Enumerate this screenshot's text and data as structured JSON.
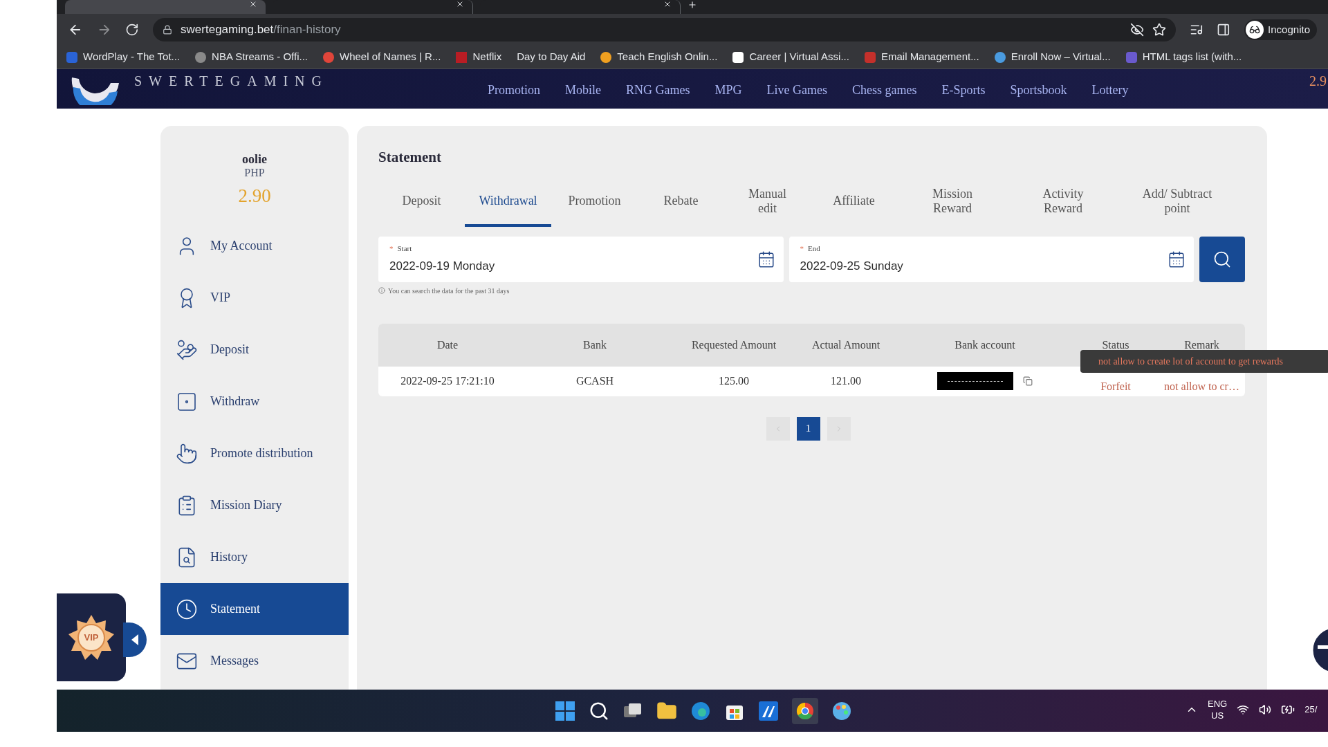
{
  "browser": {
    "tabs": [
      {
        "selected": true
      },
      {
        "selected": false
      },
      {
        "selected": false
      }
    ],
    "address": {
      "domain": "swertegaming.bet",
      "path": "/finan-history"
    },
    "profile": "Incognito",
    "bookmarks": [
      "WordPlay - The Tot...",
      "NBA Streams - Offi...",
      "Wheel of Names | R...",
      "Netflix",
      "Day to Day Aid",
      "Teach English Onlin...",
      "Career | Virtual Assi...",
      "Email Management...",
      "Enroll Now – Virtual...",
      "HTML tags list (with..."
    ]
  },
  "site": {
    "logo": "SWERTEGAMING",
    "balance_peek": "2.9",
    "nav": [
      "Promotion",
      "Mobile",
      "RNG Games",
      "MPG",
      "Live Games",
      "Chess games",
      "E-Sports",
      "Sportsbook",
      "Lottery"
    ]
  },
  "sidebar": {
    "username": "oolie",
    "currency": "PHP",
    "balance": "2.90",
    "items": [
      {
        "label": "My Account",
        "selected": false
      },
      {
        "label": "VIP",
        "selected": false
      },
      {
        "label": "Deposit",
        "selected": false
      },
      {
        "label": "Withdraw",
        "selected": false
      },
      {
        "label": "Promote distribution",
        "selected": false
      },
      {
        "label": "Mission Diary",
        "selected": false
      },
      {
        "label": "History",
        "selected": false
      },
      {
        "label": "Statement",
        "selected": true
      },
      {
        "label": "Messages",
        "selected": false
      }
    ]
  },
  "vip_badge": "VIP",
  "statement": {
    "title": "Statement",
    "tabs": [
      {
        "label": "Deposit",
        "selected": false
      },
      {
        "label": "Withdrawal",
        "selected": true
      },
      {
        "label": "Promotion",
        "selected": false
      },
      {
        "label": "Rebate",
        "selected": false
      },
      {
        "label": "Manual edit",
        "selected": false
      },
      {
        "label": "Affiliate",
        "selected": false
      },
      {
        "label": "Mission Reward",
        "selected": false
      },
      {
        "label": "Activity Reward",
        "selected": false
      },
      {
        "label": "Add/ Subtract point",
        "selected": false
      }
    ],
    "start": {
      "required_mark": "*",
      "label": "Start",
      "value": "2022-09-19 Monday"
    },
    "end": {
      "required_mark": "*",
      "label": "End",
      "value": "2022-09-25 Sunday"
    },
    "hint": "You can search the data for the past 31 days",
    "table": {
      "columns": [
        "Date",
        "Bank",
        "Requested Amount",
        "Actual Amount",
        "Bank account",
        "Status",
        "Remark"
      ],
      "rows": [
        {
          "date": "2022-09-25 17:21:10",
          "bank": "GCASH",
          "requested_amount": "125.00",
          "actual_amount": "121.00",
          "status": "Forfeit",
          "remark": "not allow to cr…"
        }
      ]
    },
    "tooltip": "not allow to create lot of account to get rewards",
    "pagination": {
      "pages": [
        {
          "label": "1",
          "selected": true
        }
      ]
    }
  },
  "taskbar": {
    "language": "ENG",
    "region": "US",
    "clock": "25/"
  }
}
